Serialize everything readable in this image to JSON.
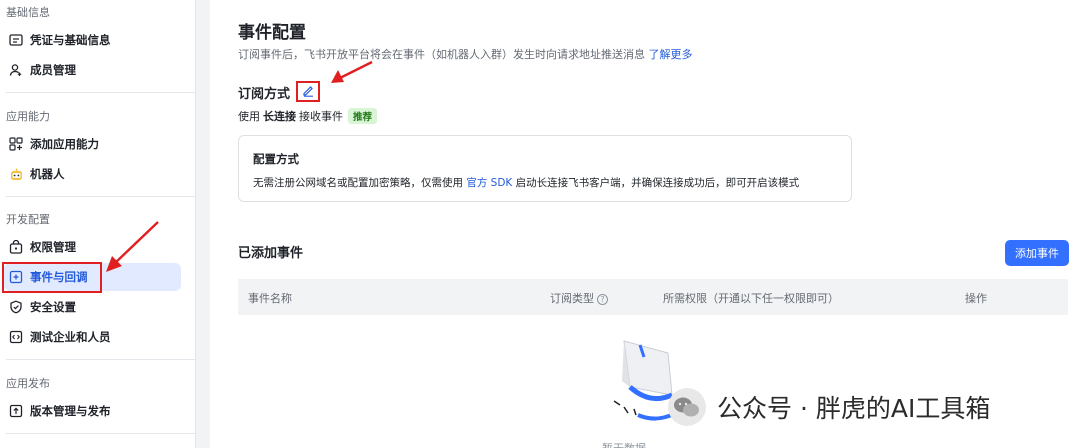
{
  "sidebar": {
    "sections": [
      {
        "title": "基础信息"
      },
      {
        "title": "应用能力"
      },
      {
        "title": "开发配置"
      },
      {
        "title": "应用发布"
      }
    ],
    "items": [
      {
        "label": "凭证与基础信息",
        "icon": "credential-icon"
      },
      {
        "label": "成员管理",
        "icon": "member-icon"
      },
      {
        "label": "添加应用能力",
        "icon": "add-capability-icon"
      },
      {
        "label": "机器人",
        "icon": "robot-icon"
      },
      {
        "label": "权限管理",
        "icon": "permission-icon"
      },
      {
        "label": "事件与回调",
        "icon": "event-callback-icon",
        "active": true
      },
      {
        "label": "安全设置",
        "icon": "shield-icon"
      },
      {
        "label": "测试企业和人员",
        "icon": "test-icon"
      },
      {
        "label": "版本管理与发布",
        "icon": "release-icon"
      }
    ]
  },
  "main": {
    "title": "事件配置",
    "description": "订阅事件后，飞书开放平台将会在事件（如机器人入群）发生时向请求地址推送消息",
    "learn_more": "了解更多",
    "subscription_title": "订阅方式",
    "mode_prefix": "使用",
    "mode_name": "长连接",
    "mode_suffix": "接收事件",
    "recommend_tag": "推荐",
    "config_card": {
      "title": "配置方式",
      "desc_prefix": "无需注册公网域名或配置加密策略，仅需使用",
      "sdk_link": "官方 SDK",
      "desc_suffix": "启动长连接飞书客户端，并确保连接成功后，即可开启该模式"
    },
    "added_title": "已添加事件",
    "add_button": "添加事件",
    "table_headers": {
      "name": "事件名称",
      "type": "订阅类型",
      "permission": "所需权限（开通以下任一权限即可）",
      "action": "操作"
    },
    "empty_text": "暂无数据"
  },
  "watermark": {
    "text": "公众号 · 胖虎的AI工具箱"
  },
  "colors": {
    "accent": "#3370ff",
    "active_bg": "#e1eaff",
    "annotation_red": "#e02020",
    "recommend_bg": "#d9f5d6"
  }
}
